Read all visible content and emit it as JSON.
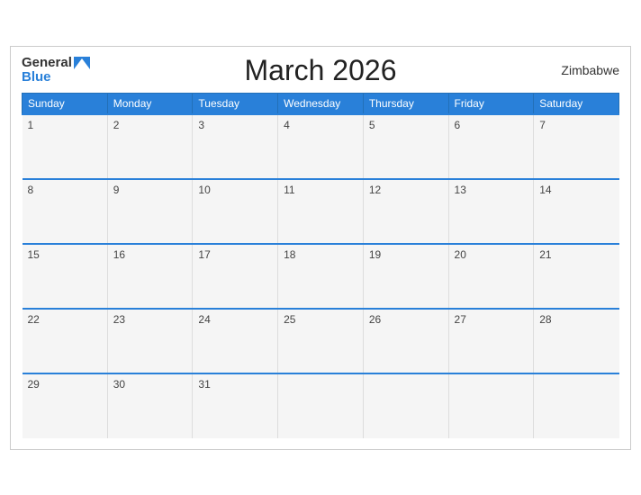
{
  "header": {
    "title": "March 2026",
    "country": "Zimbabwe",
    "logo_general": "General",
    "logo_blue": "Blue"
  },
  "weekdays": [
    "Sunday",
    "Monday",
    "Tuesday",
    "Wednesday",
    "Thursday",
    "Friday",
    "Saturday"
  ],
  "weeks": [
    [
      {
        "day": "1",
        "empty": false
      },
      {
        "day": "2",
        "empty": false
      },
      {
        "day": "3",
        "empty": false
      },
      {
        "day": "4",
        "empty": false
      },
      {
        "day": "5",
        "empty": false
      },
      {
        "day": "6",
        "empty": false
      },
      {
        "day": "7",
        "empty": false
      }
    ],
    [
      {
        "day": "8",
        "empty": false
      },
      {
        "day": "9",
        "empty": false
      },
      {
        "day": "10",
        "empty": false
      },
      {
        "day": "11",
        "empty": false
      },
      {
        "day": "12",
        "empty": false
      },
      {
        "day": "13",
        "empty": false
      },
      {
        "day": "14",
        "empty": false
      }
    ],
    [
      {
        "day": "15",
        "empty": false
      },
      {
        "day": "16",
        "empty": false
      },
      {
        "day": "17",
        "empty": false
      },
      {
        "day": "18",
        "empty": false
      },
      {
        "day": "19",
        "empty": false
      },
      {
        "day": "20",
        "empty": false
      },
      {
        "day": "21",
        "empty": false
      }
    ],
    [
      {
        "day": "22",
        "empty": false
      },
      {
        "day": "23",
        "empty": false
      },
      {
        "day": "24",
        "empty": false
      },
      {
        "day": "25",
        "empty": false
      },
      {
        "day": "26",
        "empty": false
      },
      {
        "day": "27",
        "empty": false
      },
      {
        "day": "28",
        "empty": false
      }
    ],
    [
      {
        "day": "29",
        "empty": false
      },
      {
        "day": "30",
        "empty": false
      },
      {
        "day": "31",
        "empty": false
      },
      {
        "day": "",
        "empty": true
      },
      {
        "day": "",
        "empty": true
      },
      {
        "day": "",
        "empty": true
      },
      {
        "day": "",
        "empty": true
      }
    ]
  ]
}
